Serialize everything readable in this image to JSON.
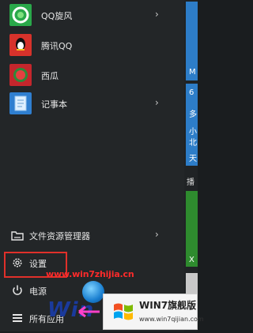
{
  "apps": [
    {
      "label": "QQ旋风",
      "icon": "qqxuanfeng-icon",
      "has_submenu": true,
      "color": "#2aa84a"
    },
    {
      "label": "腾讯QQ",
      "icon": "tencent-qq-icon",
      "has_submenu": false,
      "color": "#d7322b"
    },
    {
      "label": "西瓜",
      "icon": "xigua-icon",
      "has_submenu": false,
      "color": "#c4262c"
    },
    {
      "label": "记事本",
      "icon": "notepad-icon",
      "has_submenu": true,
      "color": "#2f7fd0"
    }
  ],
  "system": {
    "file_explorer": {
      "label": "文件资源管理器",
      "has_submenu": true
    },
    "settings": {
      "label": "设置"
    },
    "power": {
      "label": "电源"
    },
    "all_apps": {
      "label": "所有应用"
    }
  },
  "tiles": {
    "calendar_letter": "M",
    "weather_num": "6",
    "weather_line2": "多",
    "weather_line3": "小",
    "weather_line4": "北",
    "weather_line5": "天",
    "section_label": "播",
    "xbox_letter": "X"
  },
  "watermark": {
    "url": "www.win7zhijia.cn",
    "big_text": "Win",
    "badge_title": "WIN7旗舰版",
    "badge_sub": "www.win7qijian.com"
  },
  "colors": {
    "highlight": "#e0302a",
    "menu_bg": "#232628"
  }
}
